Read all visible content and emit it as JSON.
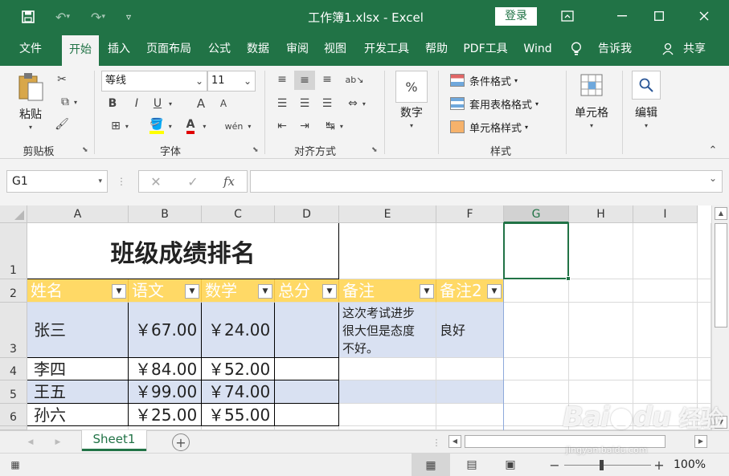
{
  "titlebar": {
    "title": "工作簿1.xlsx  -  Excel",
    "login": "登录"
  },
  "tabs": [
    "文件",
    "开始",
    "插入",
    "页面布局",
    "公式",
    "数据",
    "审阅",
    "视图",
    "开发工具",
    "帮助",
    "PDF工具",
    "Wind",
    "告诉我",
    "共享"
  ],
  "ribbon": {
    "clipboard": {
      "paste": "粘贴",
      "label": "剪贴板"
    },
    "font": {
      "name": "等线",
      "size": "11",
      "label": "字体",
      "bold": "B",
      "italic": "I",
      "underline": "U",
      "grow": "A",
      "shrink": "A",
      "phonetic": "wén"
    },
    "alignment": {
      "label": "对齐方式"
    },
    "number": {
      "label": "数字",
      "icon": "%"
    },
    "styles": {
      "label": "样式",
      "items": [
        "条件格式",
        "套用表格格式",
        "单元格样式"
      ]
    },
    "cells": {
      "label": "单元格"
    },
    "editing": {
      "label": "编辑"
    }
  },
  "formulabar": {
    "name_box": "G1",
    "fx": "fx",
    "value": ""
  },
  "columns": [
    "A",
    "B",
    "C",
    "D",
    "E",
    "F",
    "G",
    "H",
    "I"
  ],
  "rows": [
    "1",
    "2",
    "3",
    "4",
    "5",
    "6"
  ],
  "sheet": {
    "title": "班级成绩排名",
    "headers": [
      "姓名",
      "语文",
      "数学",
      "总分",
      "备注",
      "备注2"
    ],
    "data": [
      {
        "name": "张三",
        "chinese": "￥67.00",
        "math": "￥24.00",
        "total": "",
        "note": "这次考试进步很大但是态度不好。",
        "note2": "良好"
      },
      {
        "name": "李四",
        "chinese": "￥84.00",
        "math": "￥52.00",
        "total": "",
        "note": "",
        "note2": ""
      },
      {
        "name": "王五",
        "chinese": "￥99.00",
        "math": "￥74.00",
        "total": "",
        "note": "",
        "note2": ""
      },
      {
        "name": "孙六",
        "chinese": "￥25.00",
        "math": "￥55.00",
        "total": "",
        "note": "",
        "note2": ""
      }
    ],
    "note_lines": [
      "这次考试进步",
      "很大但是态度",
      "不好。"
    ]
  },
  "sheettabs": [
    "Sheet1"
  ],
  "status": {
    "zoom": "100%"
  },
  "watermark": {
    "line1": "Bai",
    "line2": "du",
    "line3": "经验",
    "sub": "jingyan.baidu.com"
  },
  "colors": {
    "accent": "#217346",
    "header_fill": "#ffd966",
    "band": "#d9e1f2"
  }
}
